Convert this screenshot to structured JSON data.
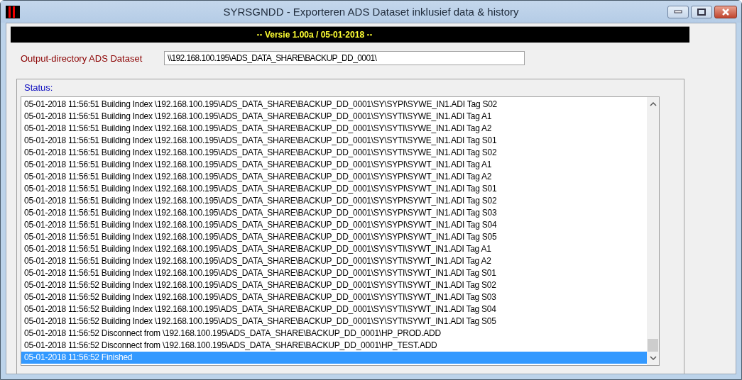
{
  "window": {
    "title": "SYRSGNDD - Exporteren ADS Dataset inklusief data & history"
  },
  "banner": "-- Versie 1.00a / 05-01-2018 --",
  "output_directory": {
    "label": "Output-directory ADS Dataset",
    "value": "\\\\192.168.100.195\\ADS_DATA_SHARE\\BACKUP_DD_0001\\"
  },
  "status": {
    "label": "Status:",
    "lines": [
      {
        "text": "05-01-2018 11:56:51 Building Index \\192.168.100.195\\ADS_DATA_SHARE\\BACKUP_DD_0001\\SY\\SYPI\\SYWE_IN1.ADI Tag S02",
        "selected": false
      },
      {
        "text": "05-01-2018 11:56:51 Building Index \\192.168.100.195\\ADS_DATA_SHARE\\BACKUP_DD_0001\\SY\\SYTI\\SYWE_IN1.ADI Tag A1",
        "selected": false
      },
      {
        "text": "05-01-2018 11:56:51 Building Index \\192.168.100.195\\ADS_DATA_SHARE\\BACKUP_DD_0001\\SY\\SYTI\\SYWE_IN1.ADI Tag A2",
        "selected": false
      },
      {
        "text": "05-01-2018 11:56:51 Building Index \\192.168.100.195\\ADS_DATA_SHARE\\BACKUP_DD_0001\\SY\\SYTI\\SYWE_IN1.ADI Tag S01",
        "selected": false
      },
      {
        "text": "05-01-2018 11:56:51 Building Index \\192.168.100.195\\ADS_DATA_SHARE\\BACKUP_DD_0001\\SY\\SYTI\\SYWE_IN1.ADI Tag S02",
        "selected": false
      },
      {
        "text": "05-01-2018 11:56:51 Building Index \\192.168.100.195\\ADS_DATA_SHARE\\BACKUP_DD_0001\\SY\\SYPI\\SYWT_IN1.ADI Tag A1",
        "selected": false
      },
      {
        "text": "05-01-2018 11:56:51 Building Index \\192.168.100.195\\ADS_DATA_SHARE\\BACKUP_DD_0001\\SY\\SYPI\\SYWT_IN1.ADI Tag A2",
        "selected": false
      },
      {
        "text": "05-01-2018 11:56:51 Building Index \\192.168.100.195\\ADS_DATA_SHARE\\BACKUP_DD_0001\\SY\\SYPI\\SYWT_IN1.ADI Tag S01",
        "selected": false
      },
      {
        "text": "05-01-2018 11:56:51 Building Index \\192.168.100.195\\ADS_DATA_SHARE\\BACKUP_DD_0001\\SY\\SYPI\\SYWT_IN1.ADI Tag S02",
        "selected": false
      },
      {
        "text": "05-01-2018 11:56:51 Building Index \\192.168.100.195\\ADS_DATA_SHARE\\BACKUP_DD_0001\\SY\\SYPI\\SYWT_IN1.ADI Tag S03",
        "selected": false
      },
      {
        "text": "05-01-2018 11:56:51 Building Index \\192.168.100.195\\ADS_DATA_SHARE\\BACKUP_DD_0001\\SY\\SYPI\\SYWT_IN1.ADI Tag S04",
        "selected": false
      },
      {
        "text": "05-01-2018 11:56:51 Building Index \\192.168.100.195\\ADS_DATA_SHARE\\BACKUP_DD_0001\\SY\\SYPI\\SYWT_IN1.ADI Tag S05",
        "selected": false
      },
      {
        "text": "05-01-2018 11:56:51 Building Index \\192.168.100.195\\ADS_DATA_SHARE\\BACKUP_DD_0001\\SY\\SYTI\\SYWT_IN1.ADI Tag A1",
        "selected": false
      },
      {
        "text": "05-01-2018 11:56:51 Building Index \\192.168.100.195\\ADS_DATA_SHARE\\BACKUP_DD_0001\\SY\\SYTI\\SYWT_IN1.ADI Tag A2",
        "selected": false
      },
      {
        "text": "05-01-2018 11:56:51 Building Index \\192.168.100.195\\ADS_DATA_SHARE\\BACKUP_DD_0001\\SY\\SYTI\\SYWT_IN1.ADI Tag S01",
        "selected": false
      },
      {
        "text": "05-01-2018 11:56:52 Building Index \\192.168.100.195\\ADS_DATA_SHARE\\BACKUP_DD_0001\\SY\\SYTI\\SYWT_IN1.ADI Tag S02",
        "selected": false
      },
      {
        "text": "05-01-2018 11:56:52 Building Index \\192.168.100.195\\ADS_DATA_SHARE\\BACKUP_DD_0001\\SY\\SYTI\\SYWT_IN1.ADI Tag S03",
        "selected": false
      },
      {
        "text": "05-01-2018 11:56:52 Building Index \\192.168.100.195\\ADS_DATA_SHARE\\BACKUP_DD_0001\\SY\\SYTI\\SYWT_IN1.ADI Tag S04",
        "selected": false
      },
      {
        "text": "05-01-2018 11:56:52 Building Index \\192.168.100.195\\ADS_DATA_SHARE\\BACKUP_DD_0001\\SY\\SYTI\\SYWT_IN1.ADI Tag S05",
        "selected": false
      },
      {
        "text": "05-01-2018 11:56:52 Disconnect from \\192.168.100.195\\ADS_DATA_SHARE\\BACKUP_DD_0001\\HP_PROD.ADD",
        "selected": false
      },
      {
        "text": "05-01-2018 11:56:52 Disconnect from \\192.168.100.195\\ADS_DATA_SHARE\\BACKUP_DD_0001\\HP_TEST.ADD",
        "selected": false
      },
      {
        "text": "05-01-2018 11:56:52 Finished",
        "selected": true
      }
    ]
  }
}
